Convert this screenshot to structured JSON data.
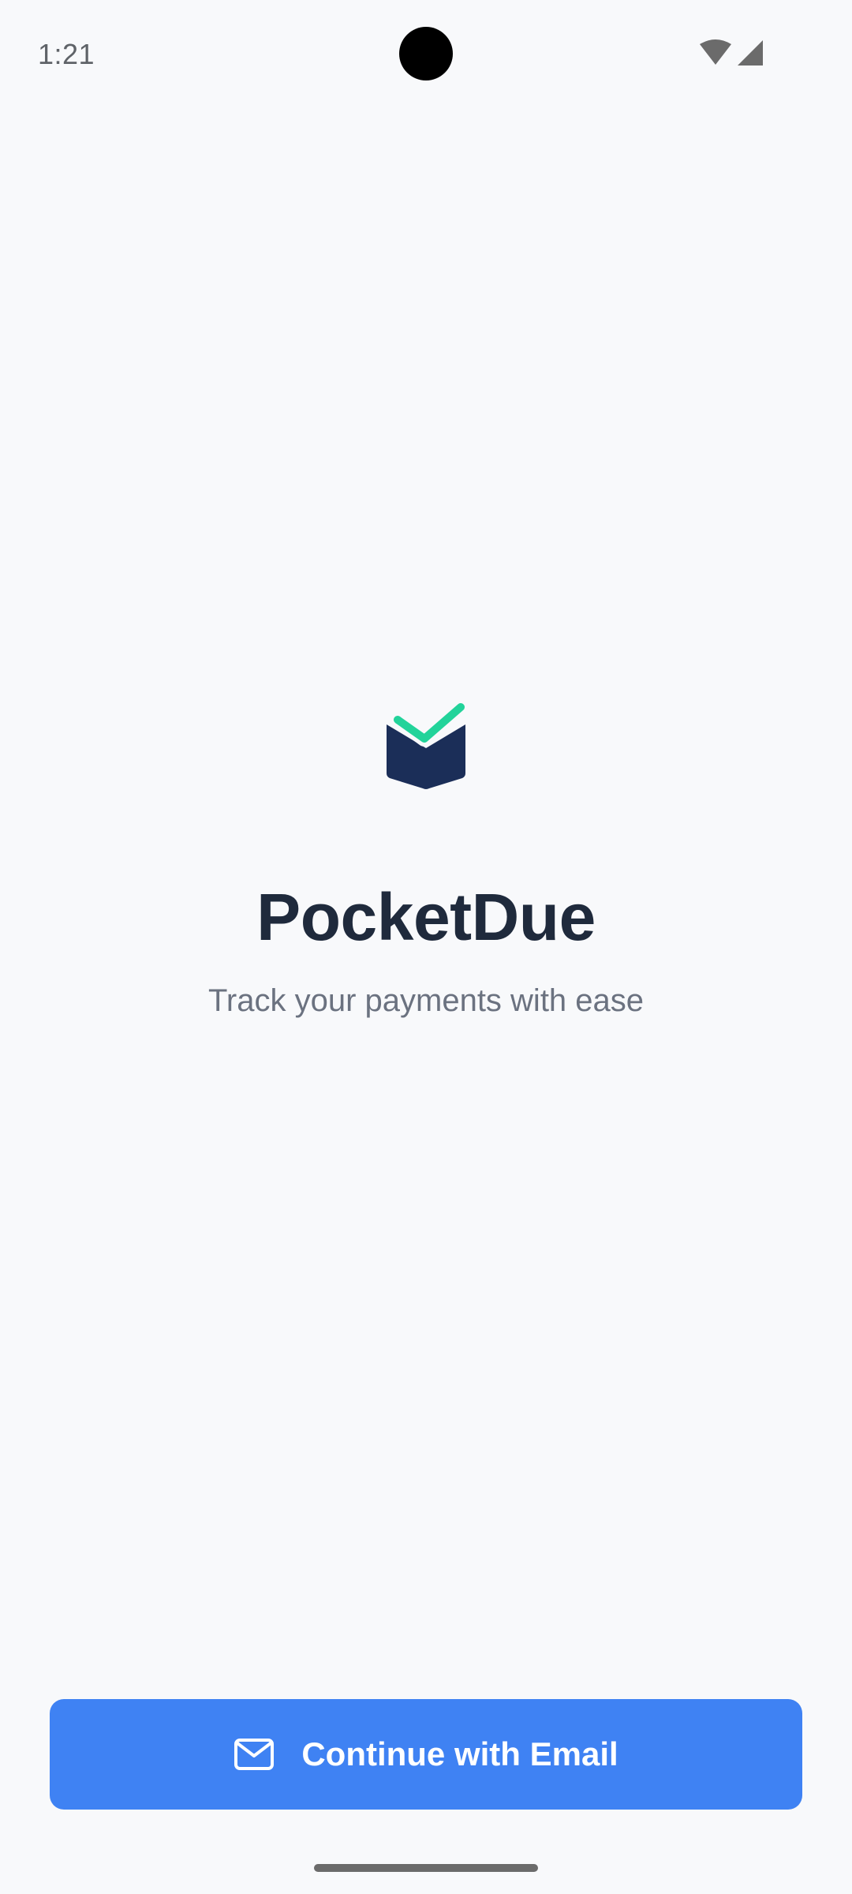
{
  "status_bar": {
    "time": "1:21",
    "icons": [
      "wifi-icon",
      "cellular-signal-icon"
    ]
  },
  "brand": {
    "logo": "pocket-check-logo",
    "title": "PocketDue",
    "tagline": "Track your payments with ease"
  },
  "cta": {
    "icon": "mail-icon",
    "label": "Continue with Email"
  },
  "colors": {
    "background": "#f8f9fb",
    "primary": "#3f82f3",
    "title": "#1f2a3c",
    "tagline": "#6b7280",
    "logo_navy": "#1b2e58",
    "logo_green": "#22d39a"
  }
}
